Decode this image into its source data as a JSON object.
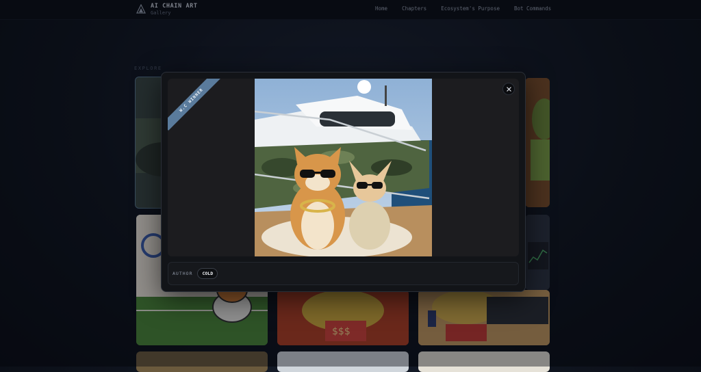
{
  "header": {
    "brand_title": "AI CHAIN ART",
    "brand_subtitle": "Gallery",
    "logo_icon": "triangle-logo-icon",
    "nav": [
      {
        "label": "Home"
      },
      {
        "label": "Chapters"
      },
      {
        "label": "Ecosystem's Purpose"
      },
      {
        "label": "Bot Commands"
      }
    ]
  },
  "main": {
    "section_label": "EXPLORE"
  },
  "modal": {
    "ribbon_label": "W.C WINNER",
    "close_icon": "close-icon",
    "author_label": "AUTHOR",
    "author_name": "COLD"
  },
  "colors": {
    "ribbon": "#5a7b9c",
    "background": "#0e131d",
    "modal_bg": "#121418"
  }
}
